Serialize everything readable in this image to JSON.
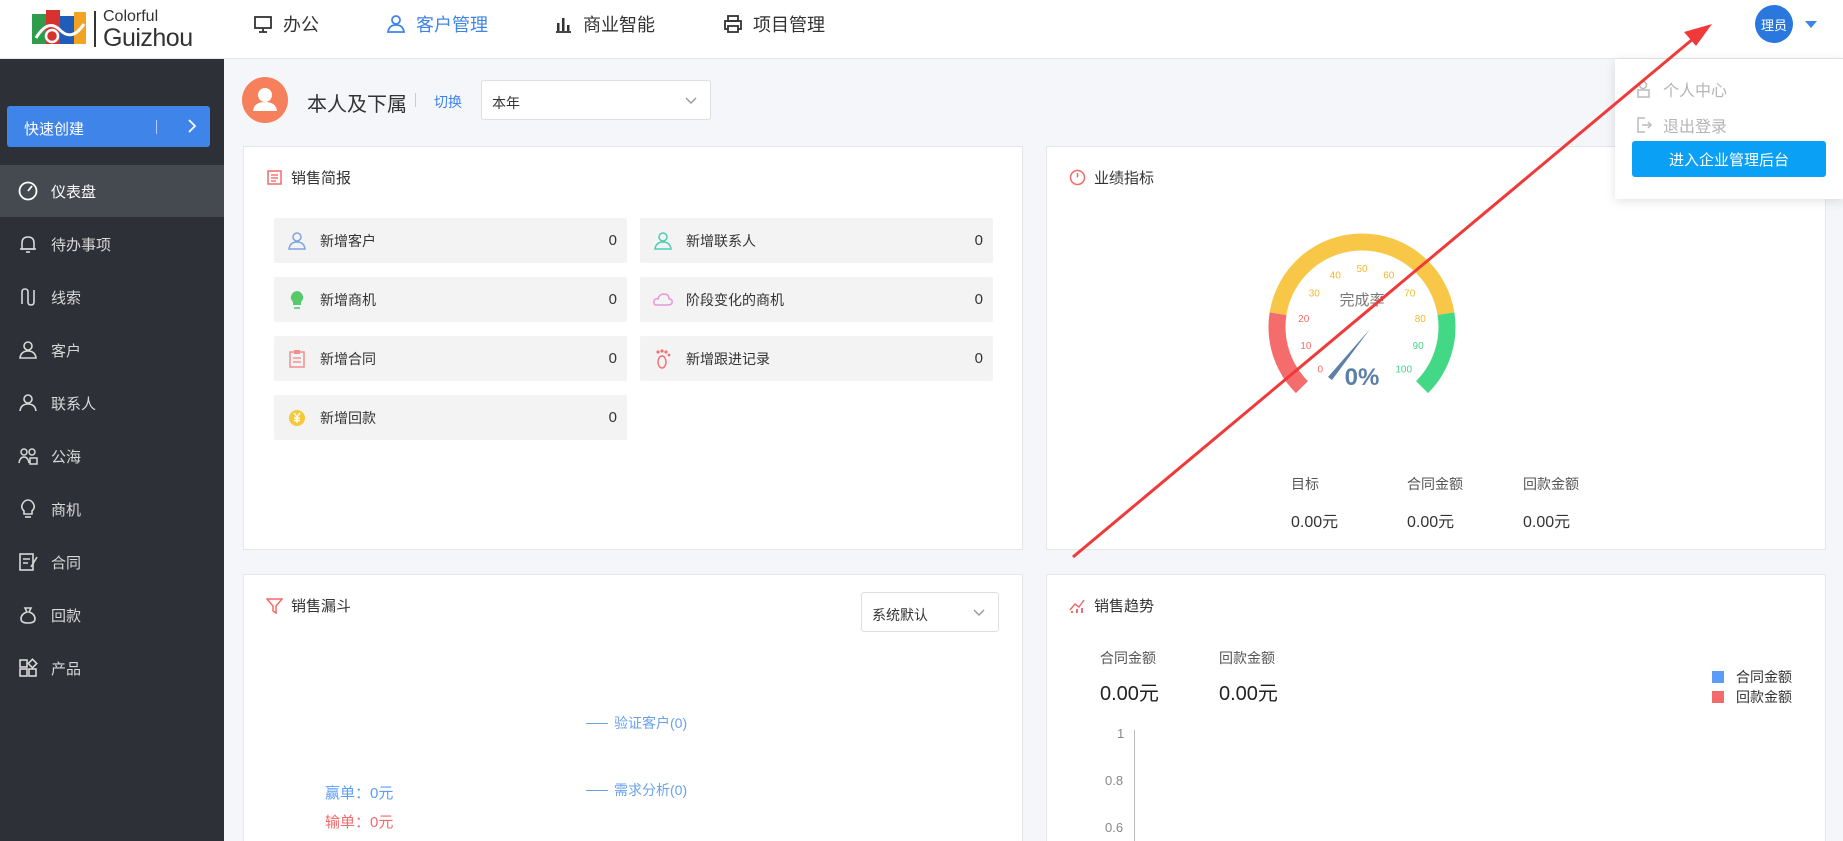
{
  "logo": {
    "line1": "Colorful",
    "line2": "Guizhou"
  },
  "nav": [
    {
      "label": "办公",
      "icon": "monitor-icon"
    },
    {
      "label": "客户管理",
      "icon": "user-icon"
    },
    {
      "label": "商业智能",
      "icon": "bar-chart-icon"
    },
    {
      "label": "项目管理",
      "icon": "printer-icon"
    }
  ],
  "user": {
    "avatar_text": "理员"
  },
  "dropdown": {
    "items": [
      {
        "label": "个人中心",
        "icon": "user-lock-icon"
      },
      {
        "label": "退出登录",
        "icon": "logout-icon"
      }
    ],
    "admin_button": "进入企业管理后台"
  },
  "sidebar": {
    "quick_create": "快速创建",
    "items": [
      {
        "label": "仪表盘",
        "icon": "dashboard-icon"
      },
      {
        "label": "待办事项",
        "icon": "bell-icon"
      },
      {
        "label": "线索",
        "icon": "clue-icon"
      },
      {
        "label": "客户",
        "icon": "customer-icon"
      },
      {
        "label": "联系人",
        "icon": "contact-icon"
      },
      {
        "label": "公海",
        "icon": "pool-icon"
      },
      {
        "label": "商机",
        "icon": "bulb-icon"
      },
      {
        "label": "合同",
        "icon": "contract-icon"
      },
      {
        "label": "回款",
        "icon": "payment-icon"
      },
      {
        "label": "产品",
        "icon": "product-icon"
      }
    ]
  },
  "scope": {
    "title": "本人及下属",
    "switch": "切换",
    "period": "本年"
  },
  "sales_brief": {
    "title": "销售简报",
    "stats": [
      {
        "label": "新增客户",
        "value": "0",
        "icon": "new-customer-icon",
        "color": "#7da5e0"
      },
      {
        "label": "新增联系人",
        "value": "0",
        "icon": "new-contact-icon",
        "color": "#4ccdb8"
      },
      {
        "label": "新增商机",
        "value": "0",
        "icon": "new-opportunity-icon",
        "color": "#58c96a"
      },
      {
        "label": "阶段变化的商机",
        "value": "0",
        "icon": "stage-change-icon",
        "color": "#e59ad6"
      },
      {
        "label": "新增合同",
        "value": "0",
        "icon": "new-contract-icon",
        "color": "#f08f8f"
      },
      {
        "label": "新增跟进记录",
        "value": "0",
        "icon": "followup-icon",
        "color": "#f07272"
      },
      {
        "label": "新增回款",
        "value": "0",
        "icon": "new-payment-icon",
        "color": "#f6c938"
      }
    ]
  },
  "performance": {
    "title": "业绩指标",
    "gauge_title": "完成率",
    "gauge_value": "0%",
    "completion": 0,
    "ticks": [
      "0",
      "10",
      "20",
      "30",
      "40",
      "50",
      "60",
      "70",
      "80",
      "90",
      "100"
    ],
    "labels": {
      "target": "目标",
      "contract": "合同金额",
      "payment": "回款金额"
    },
    "values": {
      "target": "0.00元",
      "contract": "0.00元",
      "payment": "0.00元"
    }
  },
  "funnel": {
    "title": "销售漏斗",
    "filter": "系统默认",
    "stages": [
      "验证客户(0)",
      "需求分析(0)"
    ],
    "win": "赢单：0元",
    "lose": "输单：0元"
  },
  "trend": {
    "title": "销售趋势",
    "contract_label": "合同金额",
    "contract_value": "0.00元",
    "payment_label": "回款金额",
    "payment_value": "0.00元",
    "legend": [
      {
        "label": "合同金额",
        "color": "#5b9cf6"
      },
      {
        "label": "回款金额",
        "color": "#f26a6a"
      }
    ],
    "yticks": [
      "1",
      "0.8",
      "0.6"
    ]
  }
}
